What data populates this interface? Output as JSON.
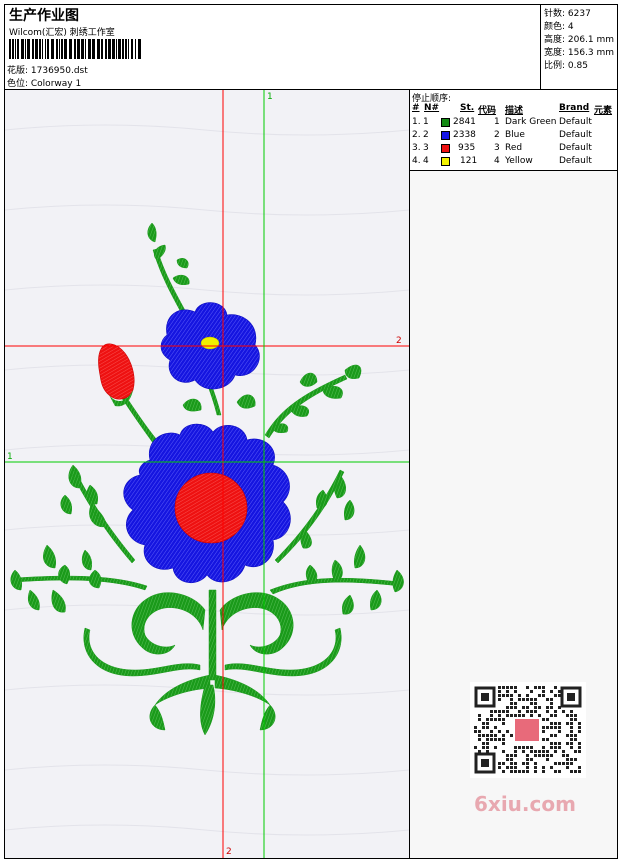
{
  "header": {
    "title": "生产作业图",
    "subtitle": "Wilcom(汇宏) 刺绣工作室",
    "design_file": "花版: 1736950.dst",
    "colorway": "色位: Colorway 1"
  },
  "stats": {
    "stitches": "针数: 6237",
    "colors": "颜色: 4",
    "height": "高度: 206.1 mm",
    "width": "宽度: 156.3 mm",
    "ratio": "比例: 0.85"
  },
  "stop_sequence": {
    "title": "停止顺序:",
    "columns": [
      "#",
      "N#",
      "St.",
      "代码",
      "描述",
      "Brand",
      "元素"
    ],
    "rows": [
      {
        "idx": "1.",
        "n": "1",
        "st": "2841",
        "code": "1",
        "desc": "Dark Green",
        "brand": "Default",
        "color": "#138a13"
      },
      {
        "idx": "2.",
        "n": "2",
        "st": "2338",
        "code": "2",
        "desc": "Blue",
        "brand": "Default",
        "color": "#1414e6"
      },
      {
        "idx": "3.",
        "n": "3",
        "st": "935",
        "code": "3",
        "desc": "Red",
        "brand": "Default",
        "color": "#ee1111"
      },
      {
        "idx": "4.",
        "n": "4",
        "st": "121",
        "code": "4",
        "desc": "Yellow",
        "brand": "Default",
        "color": "#f2f200"
      }
    ]
  },
  "guides": {
    "v_green_label": "1",
    "h_green_label": "1",
    "h_red_label": "2",
    "v_red_label": "2"
  },
  "watermark": {
    "text": "6xiu.com"
  },
  "colors": {
    "green": "#1a9a1a",
    "blue": "#1515e0",
    "red": "#ee1111",
    "yellow": "#f0f000",
    "guide_red": "#ff0000",
    "guide_green": "#00cc00"
  }
}
